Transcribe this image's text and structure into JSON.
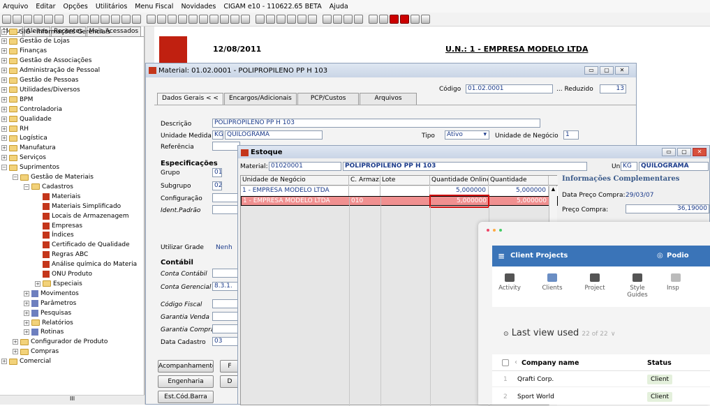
{
  "menubar": [
    "Arquivo",
    "Editar",
    "Opções",
    "Utilitários",
    "Menu Fiscal",
    "Novidades",
    "CIGAM e10 - 110622.65 BETA",
    "Ajuda"
  ],
  "left_tabs": [
    "Menu",
    "Aleitas",
    "Recentes",
    "Mais Acessados"
  ],
  "tree": [
    {
      "l": "SIG - Informações Gerenciais",
      "d": 0,
      "pm": "+",
      "ic": "folder"
    },
    {
      "l": "Gestão de Lojas",
      "d": 0,
      "pm": "+",
      "ic": "folder"
    },
    {
      "l": "Finanças",
      "d": 0,
      "pm": "+",
      "ic": "folder"
    },
    {
      "l": "Gestão de Associações",
      "d": 0,
      "pm": "+",
      "ic": "folder"
    },
    {
      "l": "Administração de Pessoal",
      "d": 0,
      "pm": "+",
      "ic": "folder"
    },
    {
      "l": "Gestão de Pessoas",
      "d": 0,
      "pm": "+",
      "ic": "folder"
    },
    {
      "l": "Utilidades/Diversos",
      "d": 0,
      "pm": "+",
      "ic": "folder"
    },
    {
      "l": "BPM",
      "d": 0,
      "pm": "+",
      "ic": "folder"
    },
    {
      "l": "Controladoria",
      "d": 0,
      "pm": "+",
      "ic": "folder"
    },
    {
      "l": "Qualidade",
      "d": 0,
      "pm": "+",
      "ic": "folder"
    },
    {
      "l": "RH",
      "d": 0,
      "pm": "+",
      "ic": "folder"
    },
    {
      "l": "Logística",
      "d": 0,
      "pm": "+",
      "ic": "folder"
    },
    {
      "l": "Manufatura",
      "d": 0,
      "pm": "+",
      "ic": "folder"
    },
    {
      "l": "Serviços",
      "d": 0,
      "pm": "+",
      "ic": "folder"
    },
    {
      "l": "Suprimentos",
      "d": 0,
      "pm": "−",
      "ic": "folder"
    },
    {
      "l": "Gestão de Materiais",
      "d": 1,
      "pm": "−",
      "ic": "folder"
    },
    {
      "l": "Cadastros",
      "d": 2,
      "pm": "−",
      "ic": "folder"
    },
    {
      "l": "Materiais",
      "d": 3,
      "pm": "",
      "ic": "red"
    },
    {
      "l": "Materiais Simplificado",
      "d": 3,
      "pm": "",
      "ic": "red"
    },
    {
      "l": "Locais de Armazenagem",
      "d": 3,
      "pm": "",
      "ic": "red"
    },
    {
      "l": "Empresas",
      "d": 3,
      "pm": "",
      "ic": "red"
    },
    {
      "l": "Índices",
      "d": 3,
      "pm": "",
      "ic": "red"
    },
    {
      "l": "Certificado de Qualidade",
      "d": 3,
      "pm": "",
      "ic": "red"
    },
    {
      "l": "Regras ABC",
      "d": 3,
      "pm": "",
      "ic": "red"
    },
    {
      "l": "Análise química do Materia",
      "d": 3,
      "pm": "",
      "ic": "red"
    },
    {
      "l": "ONU Produto",
      "d": 3,
      "pm": "",
      "ic": "red"
    },
    {
      "l": "Especiais",
      "d": 3,
      "pm": "+",
      "ic": "folder"
    },
    {
      "l": "Movimentos",
      "d": 2,
      "pm": "+",
      "ic": "blue"
    },
    {
      "l": "Parâmetros",
      "d": 2,
      "pm": "+",
      "ic": "blue"
    },
    {
      "l": "Pesquisas",
      "d": 2,
      "pm": "+",
      "ic": "blue"
    },
    {
      "l": "Relatórios",
      "d": 2,
      "pm": "+",
      "ic": "folder"
    },
    {
      "l": "Rotinas",
      "d": 2,
      "pm": "+",
      "ic": "blue"
    },
    {
      "l": "Configurador de Produto",
      "d": 1,
      "pm": "+",
      "ic": "folder"
    },
    {
      "l": "Compras",
      "d": 1,
      "pm": "+",
      "ic": "folder"
    },
    {
      "l": "Comercial",
      "d": 0,
      "pm": "+",
      "ic": "folder"
    }
  ],
  "banner": {
    "date": "12/08/2011",
    "un": "U.N.: 1 - EMPRESA MODELO LTDA"
  },
  "material": {
    "title": "Material: 01.02.0001 - POLIPROPILENO PP H 103",
    "codigo_label": "Código",
    "codigo": "01.02.0001",
    "reduzido_label": "Reduzido",
    "reduzido": "13",
    "tabs": [
      "Dados Gerais < <",
      "Encargos/Adicionais",
      "PCP/Custos",
      "Arquivos"
    ],
    "descricao_label": "Descrição",
    "descricao": "POLIPROPILENO PP H 103",
    "unidade_label": "Unidade Medida",
    "unidade_cod": "KG",
    "unidade": "QUILOGRAMA",
    "tipo_label": "Tipo",
    "tipo": "Ativo",
    "un_neg_label": "Unidade de Negócio",
    "un_neg": "1",
    "referencia_label": "Referência",
    "espec_title": "Especificações",
    "grupo_label": "Grupo",
    "grupo": "01",
    "subgrupo_label": "Subgrupo",
    "subgrupo": "02",
    "config_label": "Configuração",
    "ident_label": "Ident.Padrão",
    "grade_label": "Utilizar Grade",
    "grade": "Nenh",
    "contabil_title": "Contábil",
    "conta_contabil_label": "Conta Contábil",
    "conta_gerencial_label": "Conta Gerencial",
    "conta_gerencial": "8.3.1.",
    "codigo_fiscal_label": "Código Fiscal",
    "garantia_venda_label": "Garantia Venda",
    "garantia_compra_label": "Garantia Compra",
    "data_cad_label": "Data Cadastro",
    "data_cad": "03",
    "buttons": [
      "Acompanhamento",
      "Engenharia",
      "Est.Cód.Barra"
    ],
    "button_stubs": [
      "F",
      "D"
    ]
  },
  "estoque": {
    "title": "Estoque",
    "material_label": "Material:",
    "material": "01020001",
    "material_name": "POLIPROPILENO PP H 103",
    "un_label": "Un.:",
    "un_cod": "KG",
    "un": "QUILOGRAMA",
    "cols": [
      "Unidade de Negócio",
      "C. Armaz.",
      "Lote",
      "Quantidade Online",
      "Quantidade"
    ],
    "rows": [
      {
        "un": "1 - EMPRESA MODELO LTDA",
        "arm": "",
        "lote": "",
        "qo": "5,000000",
        "q": "5,000000"
      },
      {
        "un": "1 - EMPRESA MODELO LTDA",
        "arm": "010",
        "lote": "",
        "qo": "5,000000",
        "q": "5,000000"
      }
    ],
    "info_title": "Informações Complementares",
    "data_label": "Data Preço Compra:",
    "data": "29/03/07",
    "preco_label": "Preço Compra:",
    "preco": "36,19000"
  },
  "podio": {
    "title": "Client Projects",
    "brand": "Podio",
    "nav": [
      "Activity",
      "Clients",
      "Project",
      "Style Guides",
      "Insp"
    ],
    "last_view": "Last view used",
    "count": "22 of 22",
    "col_company": "Company name",
    "col_status": "Status",
    "rows": [
      {
        "n": "1",
        "name": "Qrafti Corp.",
        "status": "Client"
      },
      {
        "n": "2",
        "name": "Sport World",
        "status": "Client"
      }
    ]
  },
  "colors": {
    "accent_red": "#c4361b",
    "podio_blue": "#3a74b8",
    "selection": "#f09090"
  }
}
